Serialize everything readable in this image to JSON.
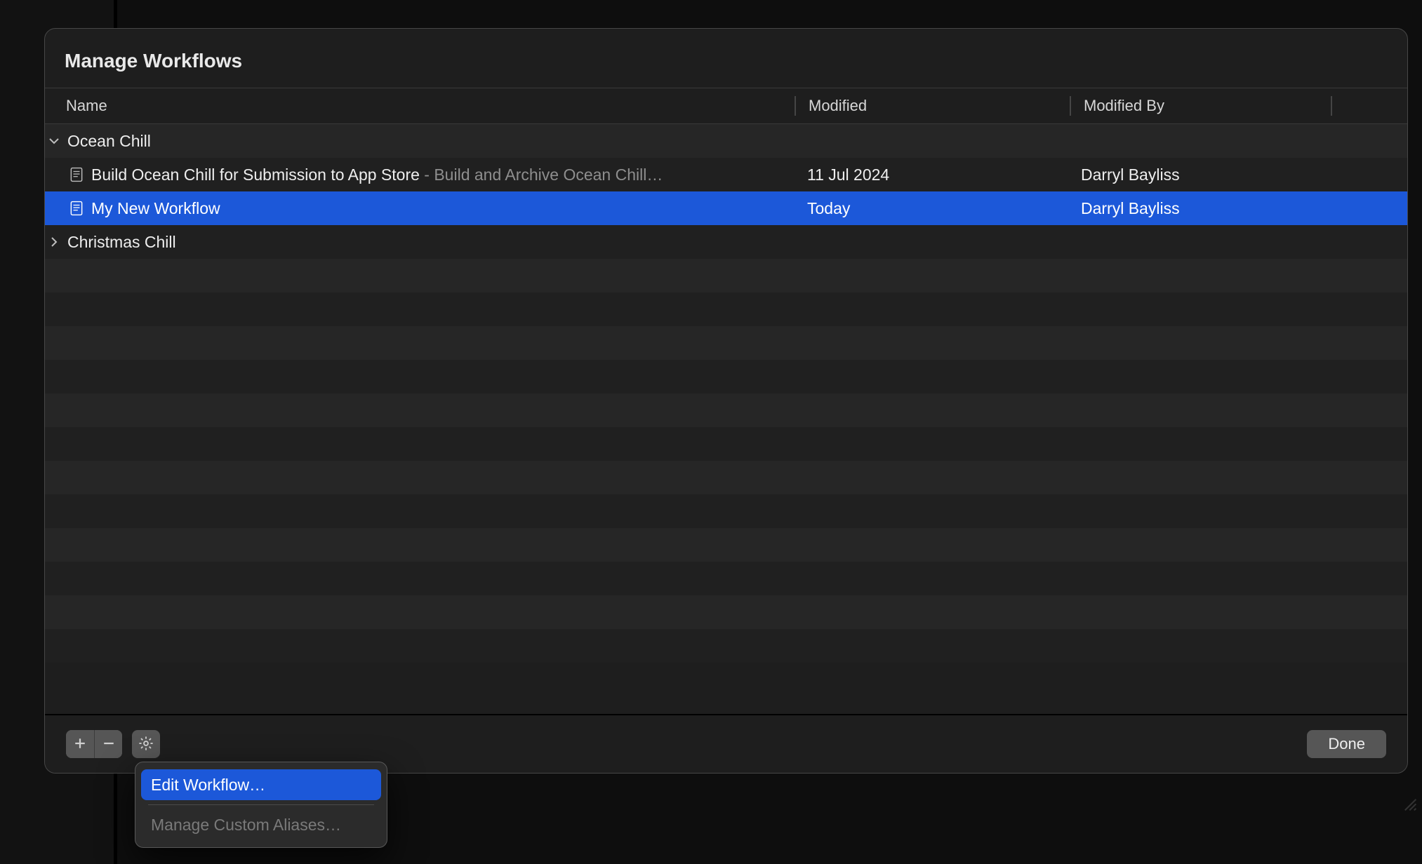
{
  "dialog": {
    "title": "Manage Workflows"
  },
  "columns": {
    "name": "Name",
    "modified": "Modified",
    "modified_by": "Modified By"
  },
  "groups": [
    {
      "name": "Ocean Chill",
      "expanded": true,
      "items": [
        {
          "title": "Build Ocean Chill for Submission to App Store",
          "subtitle": " - Build and Archive Ocean Chill…",
          "modified": "11 Jul 2024",
          "modified_by": "Darryl Bayliss",
          "selected": false
        },
        {
          "title": "My New Workflow",
          "subtitle": "",
          "modified": "Today",
          "modified_by": "Darryl Bayliss",
          "selected": true
        }
      ]
    },
    {
      "name": "Christmas Chill",
      "expanded": false,
      "items": []
    }
  ],
  "footer": {
    "done": "Done"
  },
  "menu": {
    "edit": "Edit Workflow…",
    "aliases": "Manage Custom Aliases…"
  }
}
